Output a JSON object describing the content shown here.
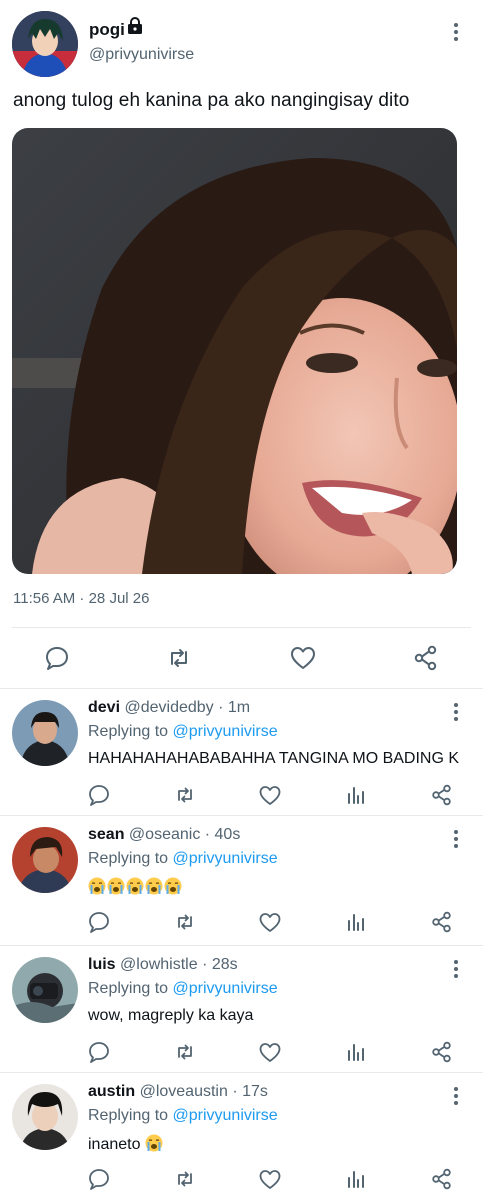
{
  "tweet": {
    "author_name": "pogi",
    "author_handle": "@privyunivirse",
    "text": "anong tulog eh kanina pa ako nangingisay dito",
    "timestamp": "11:56 AM · 28 Jul 26",
    "icons": [
      "lock-icon",
      "more-icon",
      "reply-icon",
      "retweet-icon",
      "like-icon",
      "share-icon"
    ]
  },
  "replies": [
    {
      "name": "devi",
      "handle": "@devidedby",
      "time": "1m",
      "replying_label": "Replying to",
      "replying_to": "@privyunivirse",
      "text": "HAHAHAHAHABABAHHA TANGINA MO BADING K",
      "emoji_count": 0
    },
    {
      "name": "sean",
      "handle": "@oseanic",
      "time": "40s",
      "replying_label": "Replying to",
      "replying_to": "@privyunivirse",
      "text": "",
      "emoji_count": 5
    },
    {
      "name": "luis",
      "handle": "@lowhistle",
      "time": "28s",
      "replying_label": "Replying to",
      "replying_to": "@privyunivirse",
      "text": "wow, magreply ka kaya",
      "emoji_count": 0
    },
    {
      "name": "austin",
      "handle": "@loveaustin",
      "time": "17s",
      "replying_label": "Replying to",
      "replying_to": "@privyunivirse",
      "text": "inaneto",
      "emoji_count": 1
    }
  ],
  "colors": {
    "link": "#1d9bf0",
    "secondary_text": "#536471",
    "icon": "#536471",
    "divider": "#e6e9eb"
  }
}
